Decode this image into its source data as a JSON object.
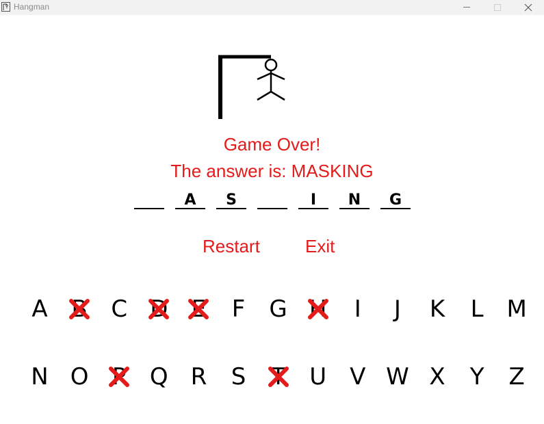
{
  "window": {
    "title": "Hangman"
  },
  "status": {
    "headline": "Game Over!",
    "answer_text": "The answer is: MASKING"
  },
  "word": {
    "slots": [
      {
        "letter": ""
      },
      {
        "letter": "A"
      },
      {
        "letter": "S"
      },
      {
        "letter": ""
      },
      {
        "letter": "I"
      },
      {
        "letter": "N"
      },
      {
        "letter": "G"
      }
    ]
  },
  "actions": {
    "restart_label": "Restart",
    "exit_label": "Exit"
  },
  "keyboard": {
    "rows": [
      [
        {
          "letter": "A",
          "wrong": false
        },
        {
          "letter": "B",
          "wrong": true
        },
        {
          "letter": "C",
          "wrong": false
        },
        {
          "letter": "D",
          "wrong": true
        },
        {
          "letter": "E",
          "wrong": true
        },
        {
          "letter": "F",
          "wrong": false
        },
        {
          "letter": "G",
          "wrong": false
        },
        {
          "letter": "H",
          "wrong": true
        },
        {
          "letter": "I",
          "wrong": false
        },
        {
          "letter": "J",
          "wrong": false
        },
        {
          "letter": "K",
          "wrong": false
        },
        {
          "letter": "L",
          "wrong": false
        },
        {
          "letter": "M",
          "wrong": false
        }
      ],
      [
        {
          "letter": "N",
          "wrong": false
        },
        {
          "letter": "O",
          "wrong": false
        },
        {
          "letter": "P",
          "wrong": true
        },
        {
          "letter": "Q",
          "wrong": false
        },
        {
          "letter": "R",
          "wrong": false
        },
        {
          "letter": "S",
          "wrong": false
        },
        {
          "letter": "T",
          "wrong": true
        },
        {
          "letter": "U",
          "wrong": false
        },
        {
          "letter": "V",
          "wrong": false
        },
        {
          "letter": "W",
          "wrong": false
        },
        {
          "letter": "X",
          "wrong": false
        },
        {
          "letter": "Y",
          "wrong": false
        },
        {
          "letter": "Z",
          "wrong": false
        }
      ]
    ]
  },
  "colors": {
    "accent": "#e41b1b",
    "cross": "#e41b1b",
    "text": "#000000"
  },
  "icons": {
    "app": "hangman-app-icon",
    "minimize": "minimize-icon",
    "maximize": "maximize-icon",
    "close": "close-icon",
    "wrong_guess": "red-x-icon"
  }
}
